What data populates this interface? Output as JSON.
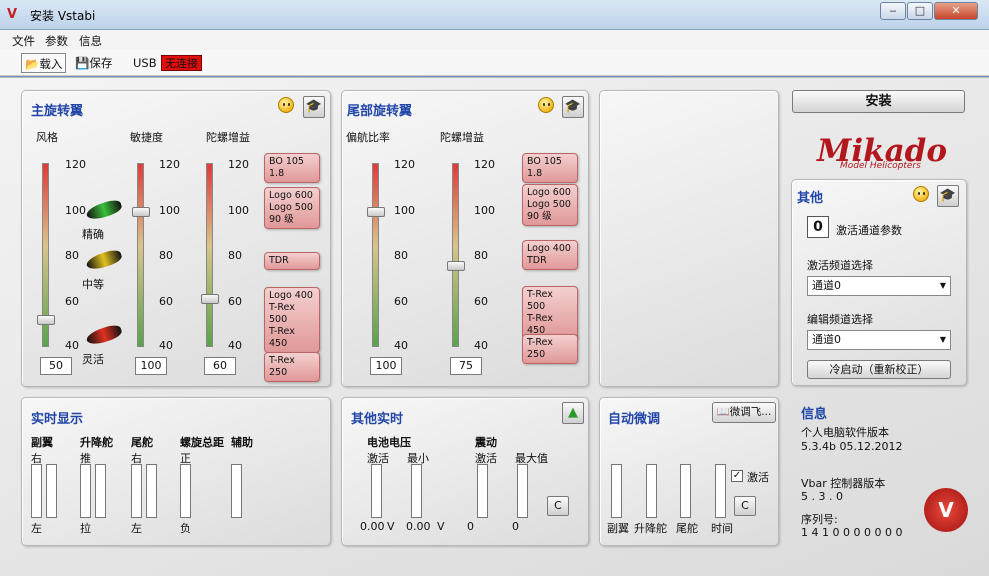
{
  "window": {
    "title": "安装 Vstabi",
    "min": "‒",
    "max": "□",
    "close": "✕"
  },
  "menu": [
    "文件",
    "参数",
    "信息"
  ],
  "toolbar": {
    "load": "载入",
    "save": "保存",
    "usb": "USB",
    "conn": "无连接"
  },
  "main_rotor": {
    "title": "主旋转翼",
    "col1": "风格",
    "col2": "敏捷度",
    "col3": "陀螺增益",
    "scale": [
      "120",
      "100",
      "80",
      "60",
      "40"
    ],
    "style_labels": [
      "精确",
      "中等",
      "灵活"
    ],
    "values": {
      "style": "50",
      "agility": "100",
      "gyro": "60"
    },
    "levels": {
      "style": 50,
      "agility": 100,
      "gyro": 60
    },
    "callouts": [
      "BO 105 1.8",
      "Logo 600\nLogo 500\n90 级",
      "TDR",
      "Logo 400\nT-Rex 500\nT-Rex 450",
      "T-Rex 250"
    ]
  },
  "tail_rotor": {
    "title": "尾部旋转翼",
    "col1": "偏航比率",
    "col2": "陀螺增益",
    "scale": [
      "120",
      "100",
      "80",
      "60",
      "40"
    ],
    "values": {
      "yaw": "100",
      "gyro": "75"
    },
    "levels": {
      "yaw": 100,
      "gyro": 75
    },
    "callouts": [
      "BO 105 1.8",
      "Logo 600\nLogo 500\n90 级",
      "Logo 400\nTDR",
      "T-Rex 500\nT-Rex 450",
      "T-Rex 250"
    ]
  },
  "install_button": "安装",
  "logo": {
    "name": "Mikado",
    "sub": "Model Helicopters"
  },
  "other": {
    "title": "其他",
    "activation_count": "0",
    "activation_params": "激活通道参数",
    "activation_channel_label": "激活频道选择",
    "activation_channel_value": "通道0",
    "edit_channel_label": "编辑频道选择",
    "edit_channel_value": "通道0",
    "cold_start": "冷启动（重新校正）"
  },
  "realtime": {
    "title": "实时显示",
    "groups": [
      {
        "name": "副翼",
        "top": "右",
        "bottom": "左"
      },
      {
        "name": "升降舵",
        "top": "推",
        "bottom": "拉"
      },
      {
        "name": "尾舵",
        "top": "右",
        "bottom": "左"
      },
      {
        "name": "螺旋总距",
        "top": "正",
        "bottom": "负"
      },
      {
        "name": "辅助",
        "top": "",
        "bottom": ""
      }
    ]
  },
  "other_realtime": {
    "title": "其他实时",
    "voltage": "电池电压",
    "vibration": "震动",
    "v_cols": [
      "激活",
      "最小"
    ],
    "vib_cols": [
      "激活",
      "最大值"
    ],
    "v_vals": [
      "0.00",
      "0.00"
    ],
    "v_unit": "V",
    "vib_vals": [
      "0",
      "0"
    ],
    "c": "C"
  },
  "autotrim": {
    "title": "自动微调",
    "trim_button": "微调飞...",
    "activate": "激活",
    "labels": [
      "副翼",
      "升降舵",
      "尾舵",
      "时间"
    ],
    "c": "C"
  },
  "info": {
    "title": "信息",
    "pc_version_label": "个人电脑软件版本",
    "pc_version": "5.3.4b  05.12.2012",
    "vbar_label": "Vbar 控制器版本",
    "vbar_version": "5 . 3 . 0",
    "serial_label": "序列号:",
    "serial": "1 4 1 0 0 0 0 0 0 0"
  }
}
